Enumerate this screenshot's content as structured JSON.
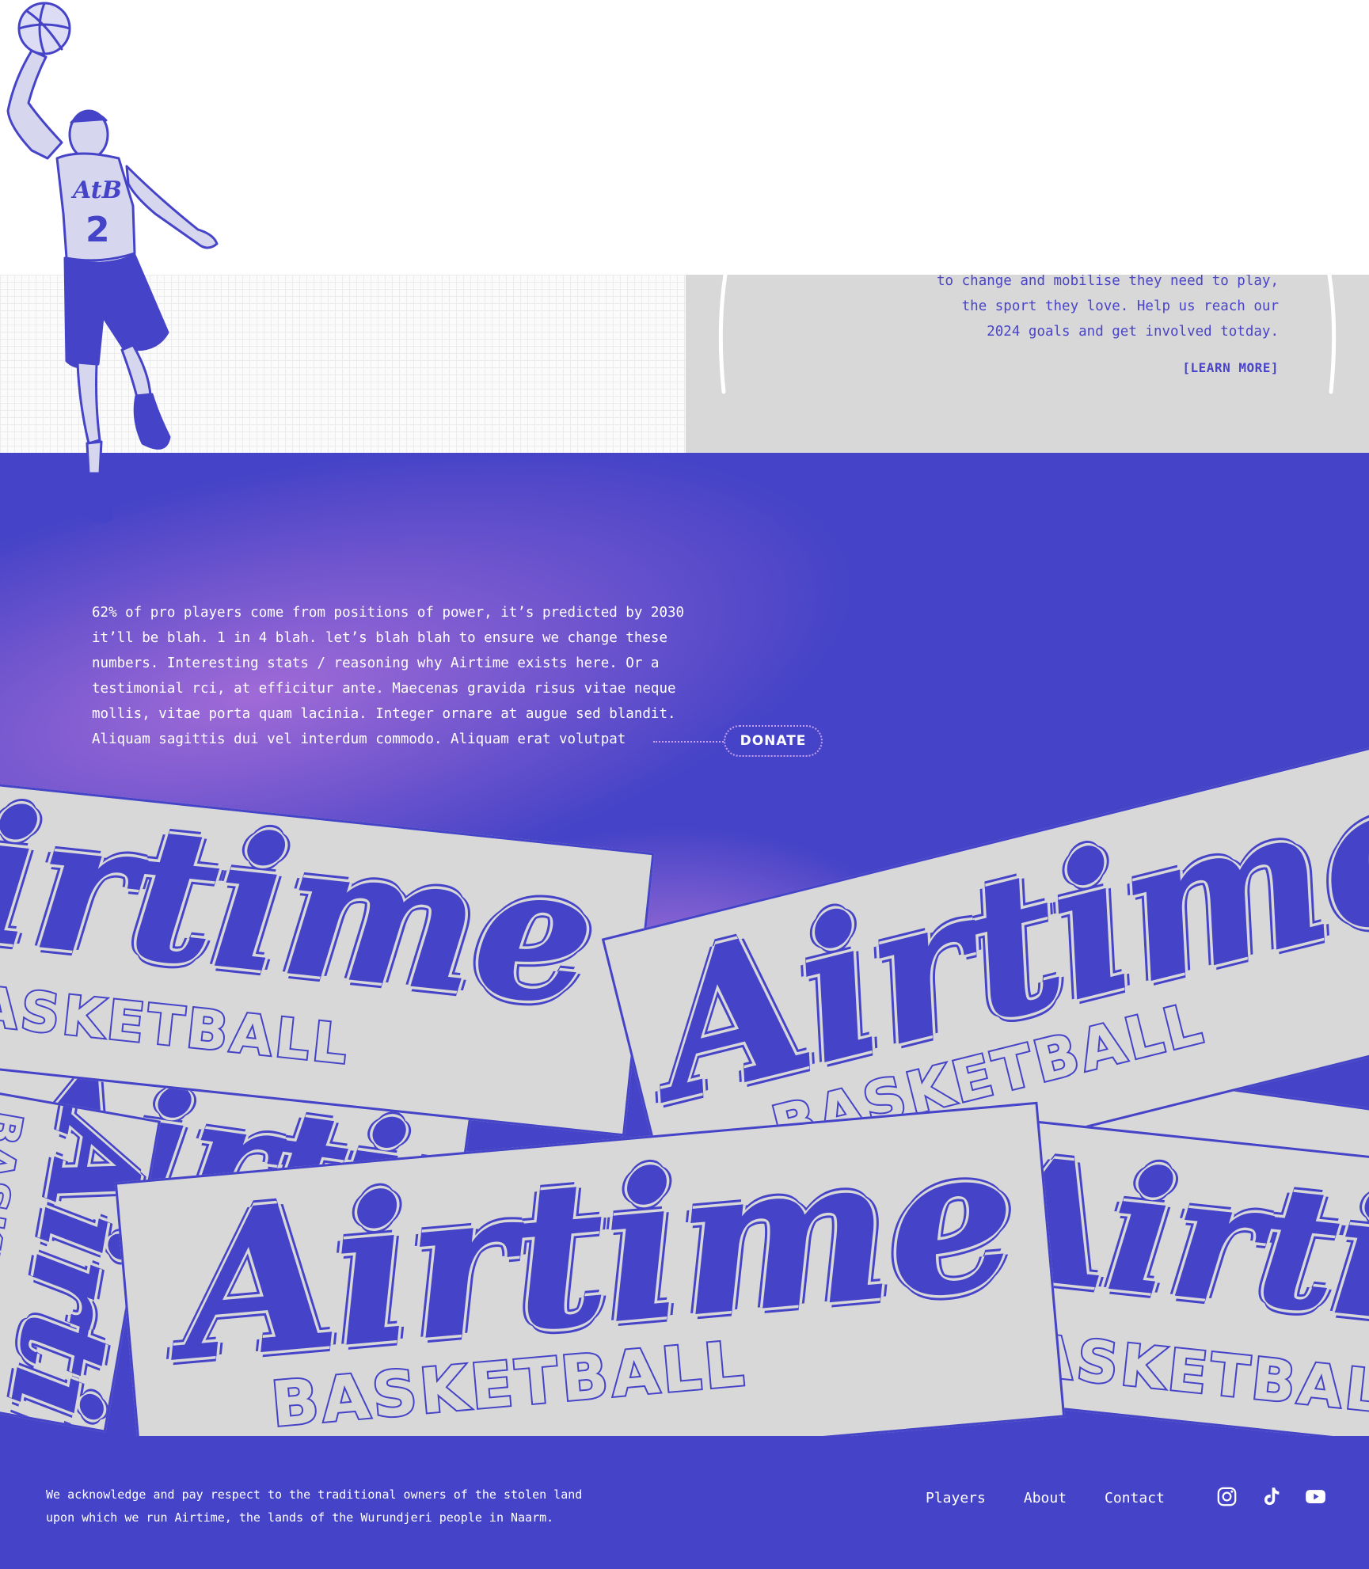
{
  "info_card": {
    "lines": [
      "to change and mobilise they need to play,",
      "the sport they love. Help us reach our",
      "2024 goals and get involved totday."
    ],
    "learn_more": "[LEARN MORE]"
  },
  "player": {
    "jersey_text": "AtB",
    "jersey_number": "2"
  },
  "stats": {
    "lines": [
      "62% of pro players come from positions of power, it’s predicted by 2030",
      "it’ll be blah. 1 in 4 blah. let’s blah blah to ensure we change these",
      "numbers. Interesting stats / reasoning why Airtime exists here. Or a",
      "testimonial rci, at efficitur ante. Maecenas gravida risus vitae neque",
      "mollis, vitae porta quam lacinia. Integer ornare at augue sed blandit.",
      "Aliquam sagittis dui vel interdum commodo. Aliquam erat volutpat"
    ],
    "donate": "DONATE"
  },
  "stickers": {
    "script": "Airtime",
    "block": "BASKETBALL"
  },
  "footer": {
    "ack_lines": [
      "We acknowledge and pay respect to the traditional owners of the stolen land",
      "upon which we run Airtime, the lands of the Wurundjeri people in Naarm."
    ],
    "nav": [
      "Players",
      "About",
      "Contact"
    ],
    "social": [
      "instagram-icon",
      "tiktok-icon",
      "youtube-icon"
    ]
  },
  "colors": {
    "brand_blue": "#4543c7",
    "card_grey": "#d8d8d8",
    "glow_purple": "#be78dc"
  }
}
